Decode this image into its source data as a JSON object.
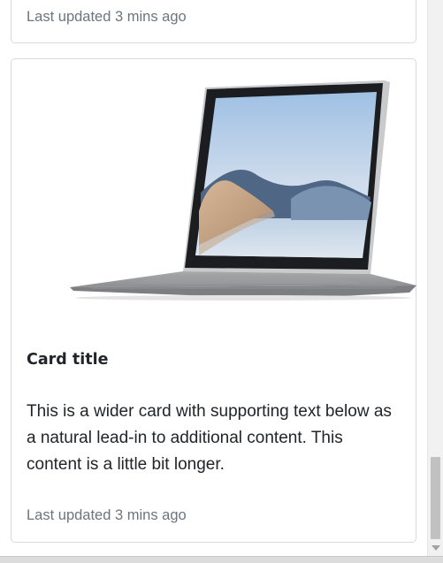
{
  "cards": {
    "top": {
      "footer_text": "Last updated 3 mins ago"
    },
    "main": {
      "image_icon": "laptop-image",
      "title": "Card title",
      "text": "This is a wider card with supporting text below as a natural lead-in to additional content. This content is a little bit longer.",
      "footer_text": "Last updated 3 mins ago"
    }
  },
  "colors": {
    "muted_text": "#6c757d",
    "card_border": "#d9d9d9",
    "scroll_thumb": "#c1c1c1"
  }
}
